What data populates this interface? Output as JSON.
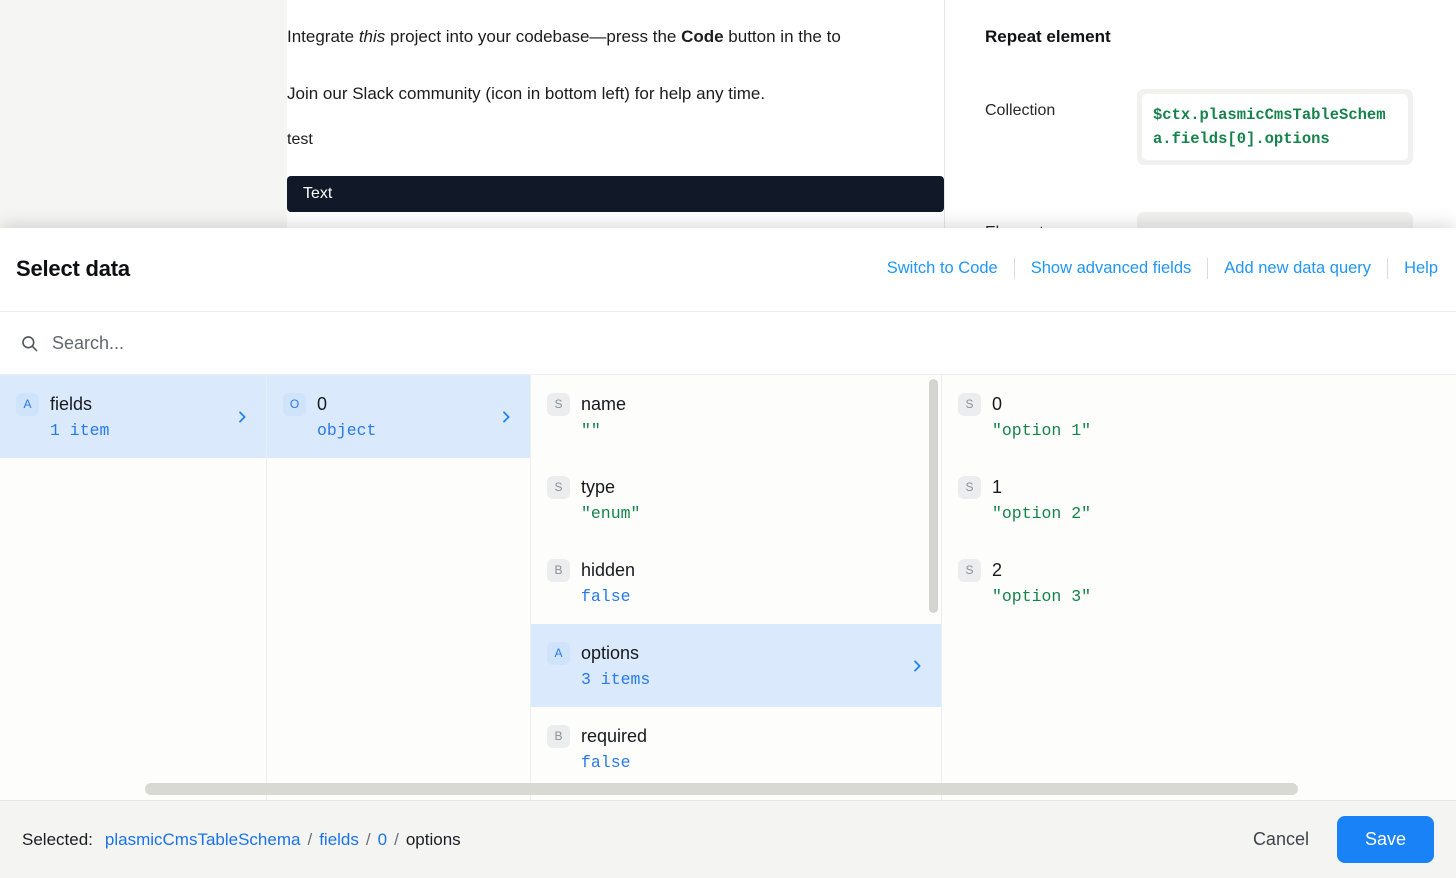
{
  "background": {
    "doc_lines": [
      "Integrate this project into your codebase—press the Code button in the to",
      "Join our Slack community (icon in bottom left) for help any time.",
      "test"
    ],
    "selected_element_tag": "Text",
    "right_panel": {
      "title": "Repeat element",
      "collection_label": "Collection",
      "collection_value": "$ctx.plasmicCmsTableSchema.fields[0].options",
      "second_label": "Element name"
    }
  },
  "modal": {
    "title": "Select data",
    "header_links": [
      {
        "label": "Switch to Code"
      },
      {
        "label": "Show advanced fields"
      },
      {
        "label": "Add new data query"
      },
      {
        "label": "Help"
      }
    ],
    "search": {
      "placeholder": "Search...",
      "value": "",
      "icon": "search-icon"
    },
    "columns": [
      {
        "name": "column-root",
        "rows": [
          {
            "key": "",
            "badge": "",
            "badge_kind": "",
            "value": "",
            "value_kind": "",
            "chevron": true,
            "selected": false,
            "chevron_only": true
          },
          {
            "key": "",
            "badge": "",
            "badge_kind": "",
            "value": "",
            "value_kind": "",
            "chevron": true,
            "selected": false,
            "chevron_only": true
          },
          {
            "key": "",
            "badge": "",
            "badge_kind": "",
            "value": "",
            "value_kind": "",
            "chevron": true,
            "selected": true,
            "chevron_only": true
          }
        ]
      },
      {
        "name": "column-fields",
        "rows": [
          {
            "key": "fields",
            "badge": "A",
            "badge_kind": "blue",
            "value": "1 item",
            "value_kind": "count",
            "chevron": true,
            "selected": true,
            "chevron_only": false
          }
        ]
      },
      {
        "name": "column-index",
        "rows": [
          {
            "key": "0",
            "badge": "O",
            "badge_kind": "blue",
            "value": "object",
            "value_kind": "count",
            "chevron": true,
            "selected": true,
            "chevron_only": false
          }
        ]
      },
      {
        "name": "column-field-props",
        "rows": [
          {
            "key": "name",
            "badge": "S",
            "badge_kind": "gray",
            "value": "\"\"",
            "value_kind": "str",
            "chevron": false,
            "selected": false,
            "chevron_only": false
          },
          {
            "key": "type",
            "badge": "S",
            "badge_kind": "gray",
            "value": "\"enum\"",
            "value_kind": "str",
            "chevron": false,
            "selected": false,
            "chevron_only": false
          },
          {
            "key": "hidden",
            "badge": "B",
            "badge_kind": "gray",
            "value": "false",
            "value_kind": "bool",
            "chevron": false,
            "selected": false,
            "chevron_only": false
          },
          {
            "key": "options",
            "badge": "A",
            "badge_kind": "blue",
            "value": "3 items",
            "value_kind": "count",
            "chevron": true,
            "selected": true,
            "chevron_only": false
          },
          {
            "key": "required",
            "badge": "B",
            "badge_kind": "gray",
            "value": "false",
            "value_kind": "bool",
            "chevron": false,
            "selected": false,
            "chevron_only": false
          }
        ]
      },
      {
        "name": "column-options",
        "rows": [
          {
            "key": "0",
            "badge": "S",
            "badge_kind": "gray",
            "value": "\"option 1\"",
            "value_kind": "str",
            "chevron": false,
            "selected": false,
            "chevron_only": false
          },
          {
            "key": "1",
            "badge": "S",
            "badge_kind": "gray",
            "value": "\"option 2\"",
            "value_kind": "str",
            "chevron": false,
            "selected": false,
            "chevron_only": false
          },
          {
            "key": "2",
            "badge": "S",
            "badge_kind": "gray",
            "value": "\"option 3\"",
            "value_kind": "str",
            "chevron": false,
            "selected": false,
            "chevron_only": false
          }
        ]
      }
    ],
    "footer": {
      "selected_label": "Selected:",
      "breadcrumb": [
        "plasmicCmsTableSchema",
        "fields",
        "0",
        "options"
      ],
      "breadcrumb_separator": "/",
      "cancel_label": "Cancel",
      "save_label": "Save"
    }
  },
  "colors": {
    "accent": "#1a82f7",
    "link": "#2196f3",
    "selected_row_bg": "#daeafc",
    "string_value": "#16824c",
    "bool_value": "#2979e8",
    "tag_bg": "#111827"
  }
}
